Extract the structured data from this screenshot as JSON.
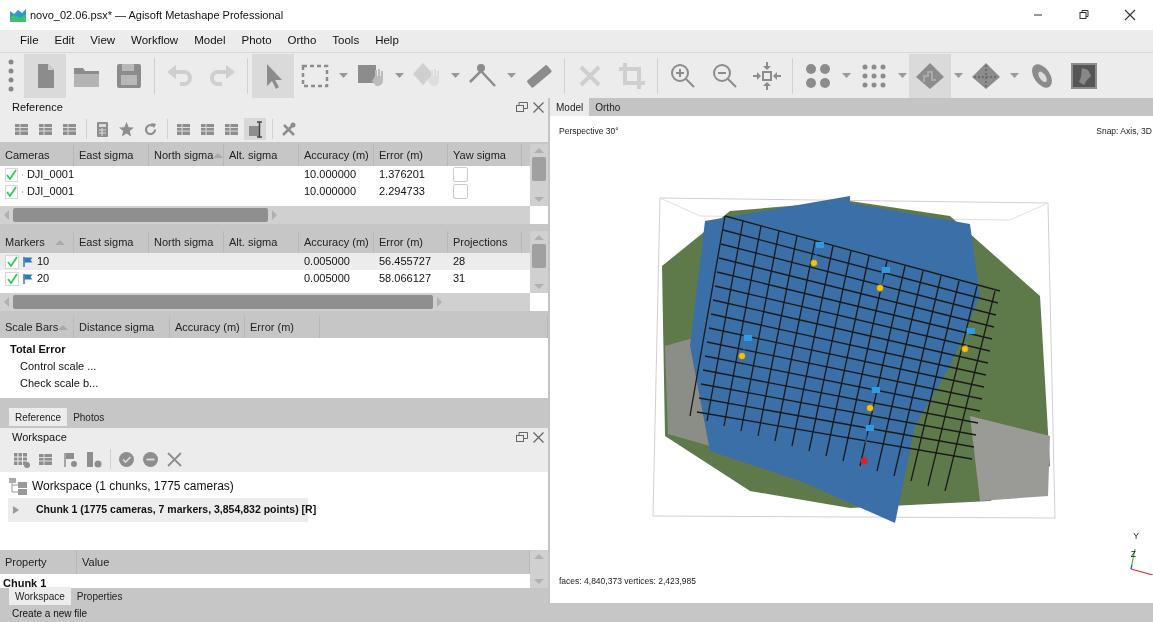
{
  "window": {
    "title": "novo_02.06.psx* — Agisoft Metashape Professional"
  },
  "menu": [
    "File",
    "Edit",
    "View",
    "Workflow",
    "Model",
    "Photo",
    "Ortho",
    "Tools",
    "Help"
  ],
  "toolbar": [
    {
      "kind": "button",
      "pressed": true,
      "disabled": false,
      "dropdown": false
    },
    {
      "kind": "button",
      "pressed": false,
      "disabled": false,
      "dropdown": false
    },
    {
      "kind": "button",
      "pressed": false,
      "disabled": false,
      "dropdown": false
    },
    {
      "kind": "separator"
    },
    {
      "kind": "button",
      "pressed": false,
      "disabled": true,
      "dropdown": false
    },
    {
      "kind": "button",
      "pressed": false,
      "disabled": true,
      "dropdown": false
    },
    {
      "kind": "separator"
    },
    {
      "kind": "button",
      "pressed": true,
      "disabled": false,
      "dropdown": false
    },
    {
      "kind": "button",
      "pressed": false,
      "disabled": false,
      "dropdown": true
    },
    {
      "kind": "button",
      "pressed": false,
      "disabled": false,
      "dropdown": true
    },
    {
      "kind": "button",
      "pressed": false,
      "disabled": true,
      "dropdown": true
    },
    {
      "kind": "button",
      "pressed": false,
      "disabled": false,
      "dropdown": true
    },
    {
      "kind": "button",
      "pressed": false,
      "disabled": false,
      "dropdown": false
    },
    {
      "kind": "separator"
    },
    {
      "kind": "button",
      "pressed": false,
      "disabled": true,
      "dropdown": false
    },
    {
      "kind": "button",
      "pressed": false,
      "disabled": true,
      "dropdown": false
    },
    {
      "kind": "separator"
    },
    {
      "kind": "button",
      "pressed": false,
      "disabled": false,
      "dropdown": false
    },
    {
      "kind": "button",
      "pressed": false,
      "disabled": false,
      "dropdown": false
    },
    {
      "kind": "button",
      "pressed": false,
      "disabled": false,
      "dropdown": false
    },
    {
      "kind": "separator"
    },
    {
      "kind": "button",
      "pressed": false,
      "disabled": false,
      "dropdown": true
    },
    {
      "kind": "button",
      "pressed": false,
      "disabled": false,
      "dropdown": true
    },
    {
      "kind": "button",
      "pressed": true,
      "disabled": false,
      "dropdown": true
    },
    {
      "kind": "button",
      "pressed": false,
      "disabled": false,
      "dropdown": true
    },
    {
      "kind": "button",
      "pressed": false,
      "disabled": false,
      "dropdown": false
    },
    {
      "kind": "button",
      "pressed": false,
      "disabled": false,
      "dropdown": false
    }
  ],
  "reference": {
    "title": "Reference",
    "toolbar": [
      {
        "kind": "button",
        "pressed": false
      },
      {
        "kind": "button",
        "pressed": false
      },
      {
        "kind": "button",
        "pressed": false
      },
      {
        "kind": "separator"
      },
      {
        "kind": "button",
        "pressed": false
      },
      {
        "kind": "button",
        "pressed": false
      },
      {
        "kind": "button",
        "pressed": false
      },
      {
        "kind": "separator"
      },
      {
        "kind": "button",
        "pressed": false
      },
      {
        "kind": "button",
        "pressed": false
      },
      {
        "kind": "button",
        "pressed": false
      },
      {
        "kind": "button",
        "pressed": true
      },
      {
        "kind": "separator"
      },
      {
        "kind": "button",
        "pressed": false
      }
    ],
    "cameras": {
      "columns": [
        {
          "label": "Cameras",
          "sorted": false
        },
        {
          "label": "East sigma",
          "sorted": false
        },
        {
          "label": "North sigma",
          "sorted": true
        },
        {
          "label": "Alt. sigma",
          "sorted": false
        },
        {
          "label": "Accuracy (m)",
          "sorted": false
        },
        {
          "label": "Error (m)",
          "sorted": false
        },
        {
          "label": "Yaw sigma",
          "sorted": false
        }
      ],
      "rows": [
        {
          "checked": true,
          "selected": false,
          "cells": [
            "DJI_0001",
            "",
            "",
            "",
            "10.000000",
            "1.376201",
            ""
          ]
        },
        {
          "checked": true,
          "selected": false,
          "cells": [
            "DJI_0001",
            "",
            "",
            "",
            "10.000000",
            "2.294733",
            ""
          ]
        }
      ]
    },
    "markers": {
      "columns": [
        {
          "label": "Markers",
          "sorted": true
        },
        {
          "label": "East sigma",
          "sorted": false
        },
        {
          "label": "North sigma",
          "sorted": false
        },
        {
          "label": "Alt. sigma",
          "sorted": false
        },
        {
          "label": "Accuracy (m)",
          "sorted": false
        },
        {
          "label": "Error (m)",
          "sorted": false
        },
        {
          "label": "Projections",
          "sorted": false
        }
      ],
      "rows": [
        {
          "checked": true,
          "selected": true,
          "cells": [
            "10",
            "",
            "",
            "",
            "0.005000",
            "56.455727",
            "28"
          ]
        },
        {
          "checked": true,
          "selected": false,
          "cells": [
            "20",
            "",
            "",
            "",
            "0.005000",
            "58.066127",
            "31"
          ]
        }
      ]
    },
    "scale_bars": {
      "columns": [
        {
          "label": "Scale Bars",
          "sorted": true
        },
        {
          "label": "Distance sigma",
          "sorted": false
        },
        {
          "label": "Accuracy (m)",
          "sorted": false
        },
        {
          "label": "Error (m)",
          "sorted": false
        }
      ],
      "total": {
        "label": "Total Error",
        "children": [
          {
            "label": "Control scale ..."
          },
          {
            "label": "Check scale b..."
          }
        ]
      }
    },
    "tabs": [
      {
        "label": "Reference",
        "selected": true
      },
      {
        "label": "Photos",
        "selected": false
      }
    ]
  },
  "workspace": {
    "title": "Workspace",
    "toolbar": [
      {
        "kind": "button"
      },
      {
        "kind": "button"
      },
      {
        "kind": "button"
      },
      {
        "kind": "button"
      },
      {
        "kind": "separator"
      },
      {
        "kind": "button"
      },
      {
        "kind": "button"
      },
      {
        "kind": "button"
      }
    ],
    "tree": {
      "label": "Workspace (1 chunks, 1775 cameras)",
      "children": [
        {
          "label": "Chunk 1 (1775 cameras, 7 markers, 3,854,832 points) [R]",
          "expanded": false,
          "selected": true
        }
      ]
    },
    "properties": {
      "columns": [
        "Property",
        "Value"
      ],
      "rows": [
        {
          "label": "Chunk 1"
        }
      ]
    },
    "tabs": [
      {
        "label": "Workspace",
        "selected": true
      },
      {
        "label": "Properties",
        "selected": false
      }
    ]
  },
  "viewport": {
    "tabs": [
      {
        "label": "Model",
        "selected": true
      },
      {
        "label": "Ortho",
        "selected": false
      }
    ],
    "projection": "Perspective 30°",
    "snap": "Snap: Axis, 3D",
    "stats": "faces: 4,840,373 vertices: 2,423,985",
    "axes": [
      "Y",
      "Z"
    ]
  },
  "status_bar": "Create a new file"
}
